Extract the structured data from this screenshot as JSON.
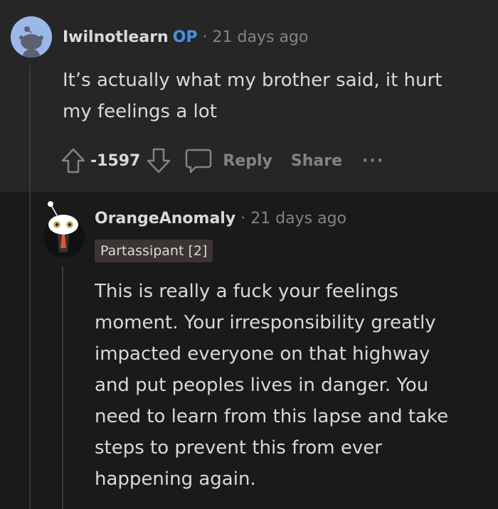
{
  "comment1": {
    "username": "Iwilnotlearn",
    "op_badge": "OP",
    "separator": "·",
    "timestamp": "21 days ago",
    "text_lines": [
      "It’s actually what my brother said, it hurt",
      "my feelings a lot"
    ],
    "score": "-1597",
    "reply_label": "Reply",
    "share_label": "Share",
    "more_label": "···"
  },
  "comment2": {
    "username": "OrangeAnomaly",
    "separator": "·",
    "timestamp": "21 days ago",
    "flair": "Partassipant [2]",
    "text_lines": [
      "This is really a fuck your feelings",
      "moment. Your irresponsibility greatly",
      "impacted everyone on that highway",
      "and put peoples lives in danger. You",
      "need to learn from this lapse and take",
      "steps to prevent this from ever",
      "happening again."
    ]
  },
  "icons": {
    "upvote": "arrow-up-icon",
    "downvote": "arrow-down-icon",
    "reply": "speech-bubble-icon",
    "more": "ellipsis-icon"
  },
  "colors": {
    "background": "#1a1a1b",
    "comment_highlight": "#262627",
    "op_badge": "#4a90e2",
    "flair_bg": "#3b3430",
    "muted": "#818384"
  }
}
